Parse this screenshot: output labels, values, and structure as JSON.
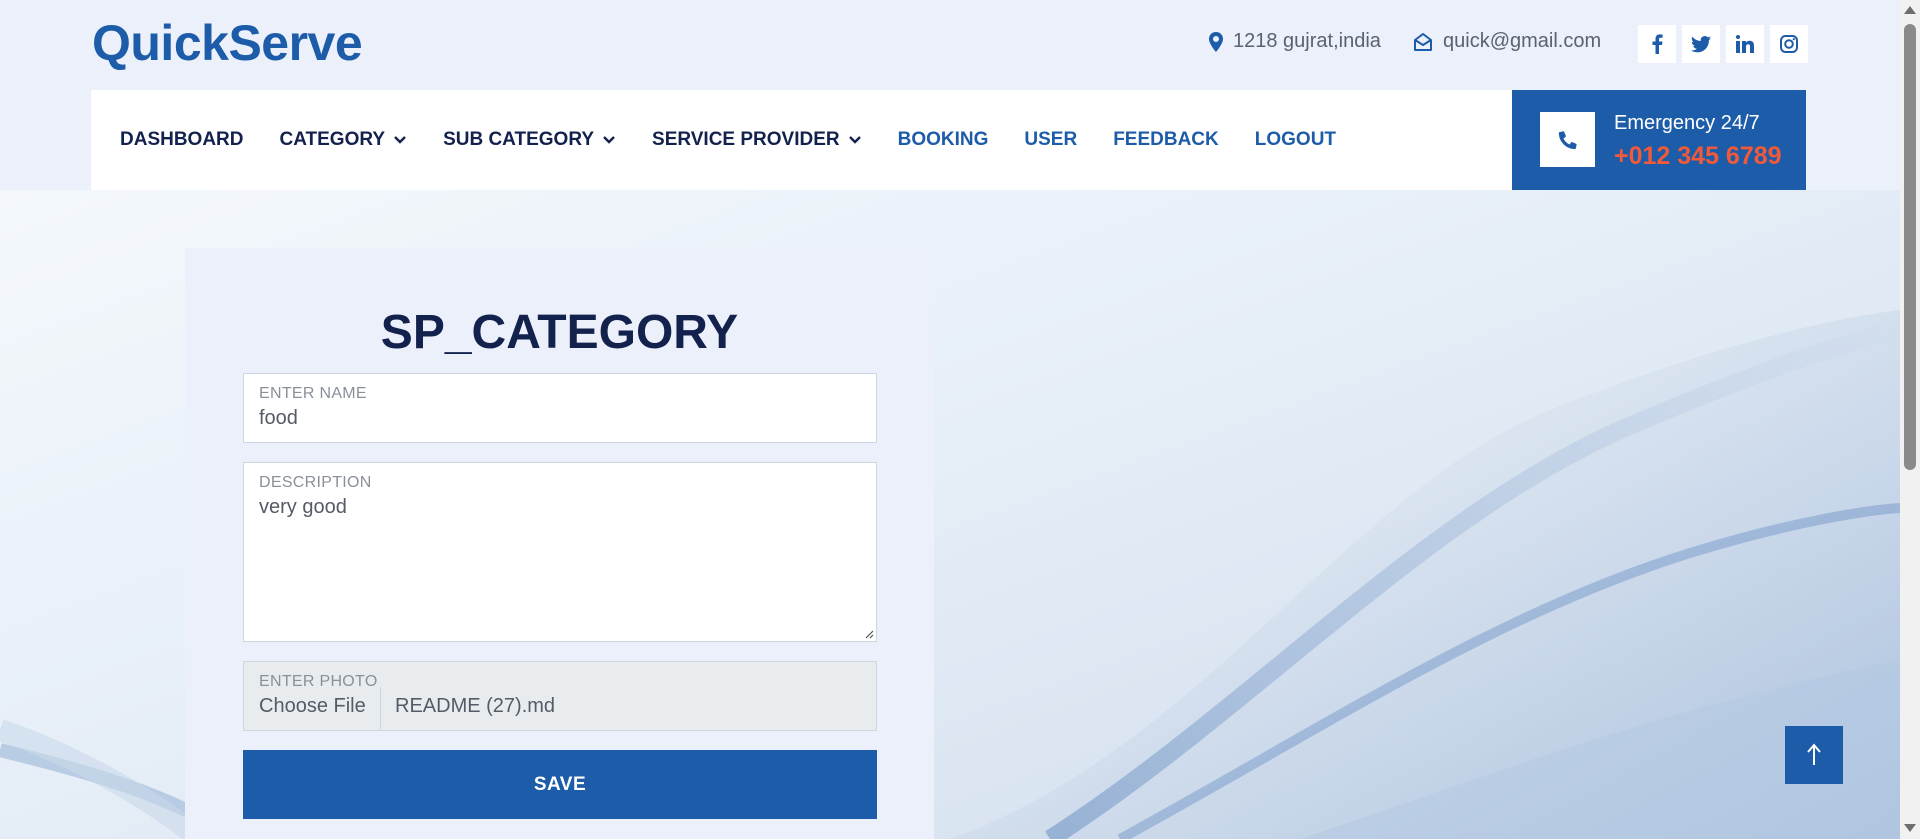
{
  "brand": "QuickServe",
  "contact": {
    "address": "1218 gujrat,india",
    "email": "quick@gmail.com"
  },
  "socials": [
    {
      "icon": "facebook-icon",
      "glyph": "f"
    },
    {
      "icon": "twitter-icon",
      "glyph": "t"
    },
    {
      "icon": "linkedin-icon",
      "glyph": "in"
    },
    {
      "icon": "instagram-icon",
      "glyph": "ig"
    }
  ],
  "nav": {
    "dashboard": "DASHBOARD",
    "category": "CATEGORY",
    "sub_category": "SUB CATEGORY",
    "service_provider": "SERVICE PROVIDER",
    "booking": "BOOKING",
    "user": "USER",
    "feedback": "FEEDBACK",
    "logout": "LOGOUT"
  },
  "emergency": {
    "title": "Emergency 24/7",
    "phone": "+012 345 6789"
  },
  "form": {
    "title": "SP_CATEGORY",
    "name_label": "ENTER NAME",
    "name_value": "food",
    "description_label": "DESCRIPTION",
    "description_value": "very good",
    "photo_label": "ENTER PHOTO",
    "choose_file": "Choose File",
    "file_name": "README (27).md",
    "save_label": "SAVE"
  },
  "colors": {
    "primary": "#1d5ca8",
    "navy": "#13214d",
    "accent": "#f05a3a",
    "page_bg": "#ebf0fa"
  }
}
